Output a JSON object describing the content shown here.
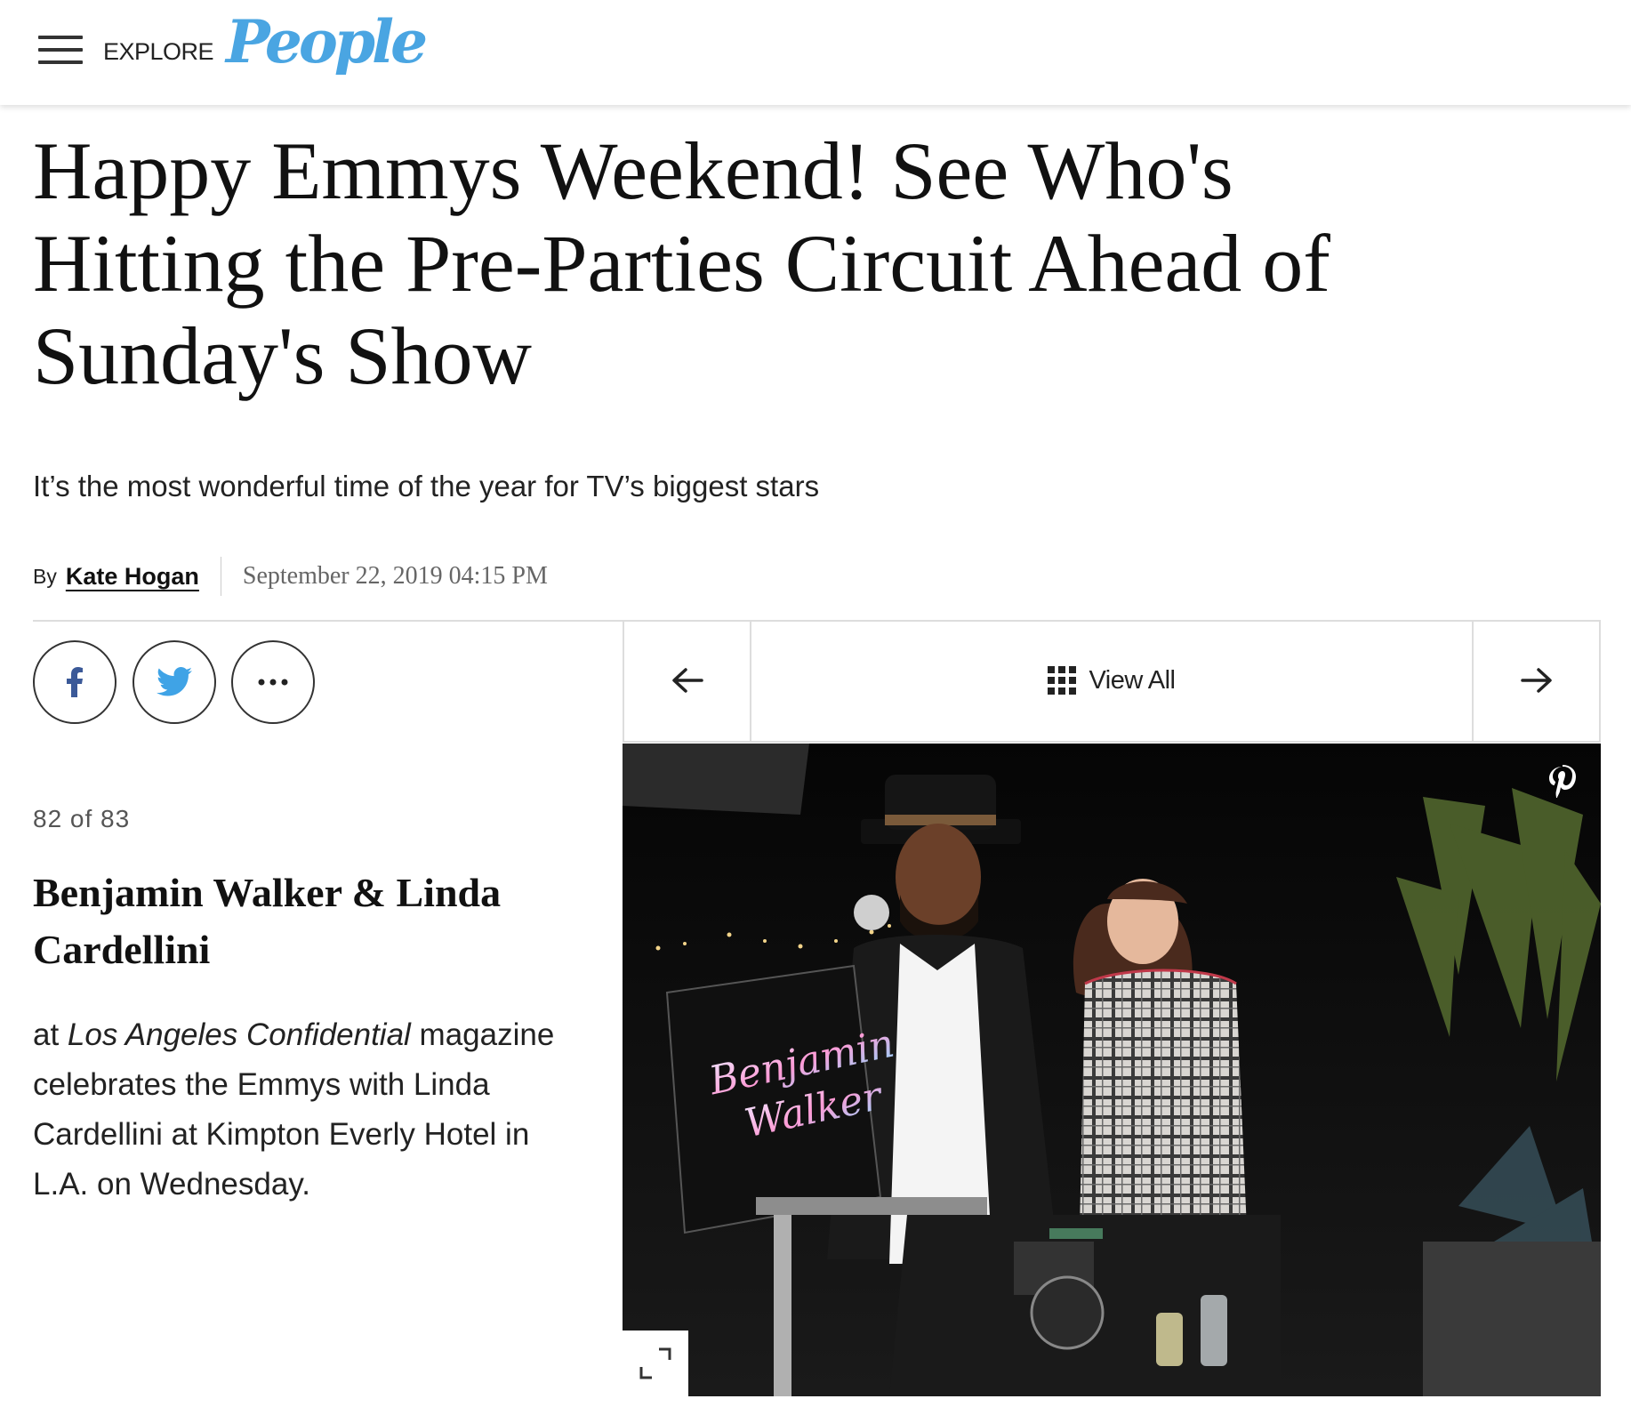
{
  "header": {
    "menu_icon": "hamburger-icon",
    "explore_label": "EXPLORE",
    "logo_text": "People",
    "logo_color": "#4aa5e2"
  },
  "article": {
    "headline_lines": [
      "Happy Emmys Weekend! See Who's",
      "Hitting the Pre-Parties Circuit Ahead of",
      "Sunday's Show"
    ],
    "dek": "It’s the most wonderful time of the year for TV’s biggest stars",
    "by_label": "By",
    "author": "Kate Hogan",
    "date": "September 22, 2019 04:15 PM"
  },
  "share": {
    "facebook_icon": "facebook-icon",
    "twitter_icon": "twitter-icon",
    "more_icon": "more-icon"
  },
  "gallery": {
    "counter": "82 of 83",
    "slide_title_lines": [
      "Benjamin Walker & Linda",
      "Cardellini"
    ],
    "caption_prefix": "at ",
    "caption_em": "Los Angeles Confidential",
    "caption_rest": " magazine celebrates the Emmys with Linda Cardellini at Kimpton Everly Hotel in L.A. on Wednesday.",
    "prev_icon": "arrow-left-icon",
    "next_icon": "arrow-right-icon",
    "grid_icon": "grid-icon",
    "view_all_label": "View All",
    "pinterest_icon": "pinterest-icon",
    "expand_icon": "expand-icon",
    "photo_text": [
      "Benjamin",
      "Walker"
    ]
  }
}
